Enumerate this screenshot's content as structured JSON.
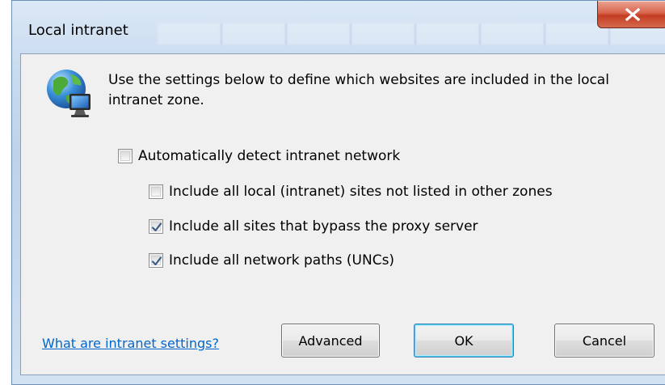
{
  "dialog": {
    "title": "Local intranet",
    "description": "Use the settings below to define which websites are included in the local intranet zone."
  },
  "options": [
    {
      "label": "Automatically detect intranet network",
      "checked": false
    },
    {
      "label": "Include all local (intranet) sites not listed in other zones",
      "checked": false
    },
    {
      "label": "Include all sites that bypass the proxy server",
      "checked": true
    },
    {
      "label": "Include all network paths (UNCs)",
      "checked": true
    }
  ],
  "footer": {
    "help_link": "What are intranet settings?",
    "advanced_label": "Advanced",
    "ok_label": "OK",
    "cancel_label": "Cancel"
  },
  "colors": {
    "link": "#0066cc",
    "close_button": "#c33d22",
    "check_mark": "#3b5a8a"
  },
  "icons": {
    "zone": "globe-computer-icon",
    "close": "close-icon",
    "check": "check-icon"
  }
}
